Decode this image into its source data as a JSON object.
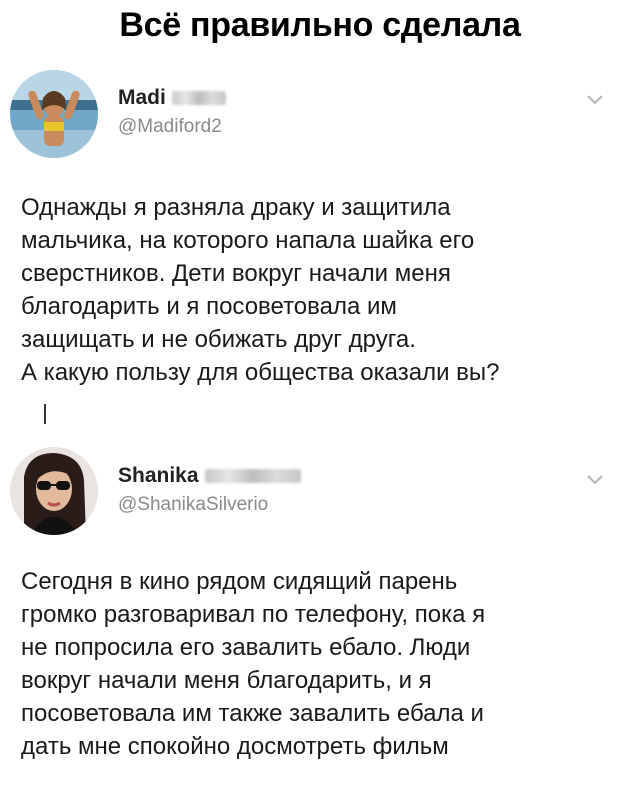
{
  "header": {
    "title": "Всё правильно сделала"
  },
  "tweets": [
    {
      "name": "Madi",
      "handle": "@Madiford2",
      "text": "Однажды я разняла драку и защитила\nмальчика, на которого напала шайка его\nсверстников. Дети вокруг начали меня\nблагодарить и я посоветовала им\nзащищать и не обижать друг друга.\nА какую пользу для общества оказали вы?",
      "avatar_icon": "user-photo-icon",
      "menu_icon": "chevron-down-icon"
    },
    {
      "name": "Shanika",
      "handle": "@ShanikaSilverio",
      "text": "Сегодня в кино рядом сидящий парень\nгромко разговаривал по телефону, пока я\nне попросила его завалить ебало. Люди\nвокруг начали меня благодарить, и я\nпосоветовала им также завалить ебала и\nдать мне спокойно досмотреть фильм",
      "avatar_icon": "user-photo-icon",
      "menu_icon": "chevron-down-icon"
    }
  ],
  "colors": {
    "text": "#1a1a1a",
    "handle": "#8a8a8a",
    "background": "#ffffff"
  }
}
